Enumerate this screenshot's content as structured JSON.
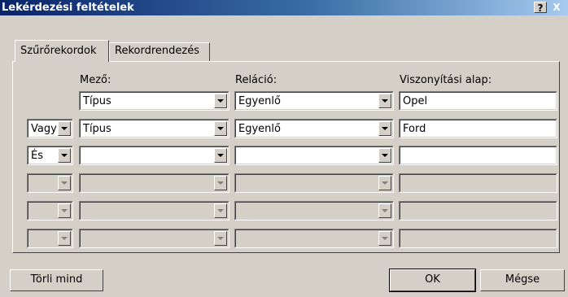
{
  "window": {
    "title": "Lekérdezési feltételek",
    "help_label": "?",
    "close_label": "X"
  },
  "tabs": [
    {
      "label": "Szűrőrekordok",
      "active": true
    },
    {
      "label": "Rekordrendezés",
      "active": false
    }
  ],
  "headers": {
    "field": "Mező:",
    "relation": "Reláció:",
    "compare": "Viszonyítási alap:"
  },
  "rows": [
    {
      "conj": "",
      "field": "Típus",
      "relation": "Egyenlő",
      "compare": "Opel",
      "enabled": true
    },
    {
      "conj": "Vagy",
      "field": "Típus",
      "relation": "Egyenlő",
      "compare": "Ford",
      "enabled": true
    },
    {
      "conj": "És",
      "field": "",
      "relation": "",
      "compare": "",
      "enabled": true
    },
    {
      "conj": "",
      "field": "",
      "relation": "",
      "compare": "",
      "enabled": false
    },
    {
      "conj": "",
      "field": "",
      "relation": "",
      "compare": "",
      "enabled": false
    },
    {
      "conj": "",
      "field": "",
      "relation": "",
      "compare": "",
      "enabled": false
    }
  ],
  "buttons": {
    "clear_all": "Törli mind",
    "ok": "OK",
    "cancel": "Mégse"
  },
  "icons": {
    "dropdown": "chevron-down-icon"
  }
}
